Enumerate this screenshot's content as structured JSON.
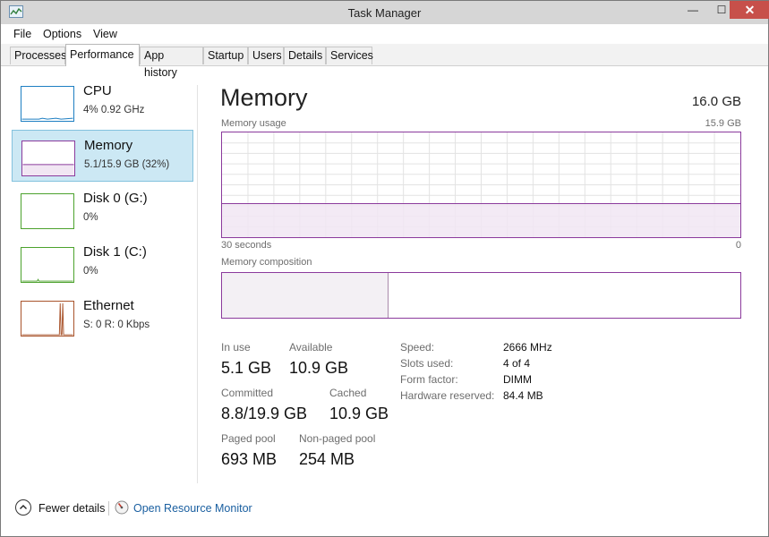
{
  "window": {
    "title": "Task Manager",
    "close_glyph": "✕",
    "minimize_glyph": "—",
    "maximize_glyph": "☐"
  },
  "menu": [
    "File",
    "Options",
    "View"
  ],
  "tabs": [
    "Processes",
    "Performance",
    "App history",
    "Startup",
    "Users",
    "Details",
    "Services"
  ],
  "active_tab": "Performance",
  "sidebar": {
    "items": [
      {
        "name": "CPU",
        "value": "4% 0.92 GHz",
        "color": "#1e7fc2",
        "icon": "cpu-graph"
      },
      {
        "name": "Memory",
        "value": "5.1/15.9 GB (32%)",
        "color": "#8b3a9c",
        "icon": "memory-graph",
        "level": 0.32
      },
      {
        "name": "Disk 0 (G:)",
        "value": "0%",
        "color": "#4ca22d",
        "icon": "disk-graph"
      },
      {
        "name": "Disk 1 (C:)",
        "value": "0%",
        "color": "#4ca22d",
        "icon": "disk-graph"
      },
      {
        "name": "Ethernet",
        "value": "S: 0 R: 0 Kbps",
        "color": "#a9542c",
        "icon": "ethernet-graph"
      }
    ]
  },
  "memory": {
    "title": "Memory",
    "total": "16.0 GB",
    "usage_label": "Memory usage",
    "usage_max": "15.9 GB",
    "time_label": "30 seconds",
    "time_end": "0",
    "composition_label": "Memory composition",
    "usage_fraction": 0.32,
    "accent": "#8b3a9c",
    "stats": {
      "in_use_label": "In use",
      "in_use": "5.1 GB",
      "available_label": "Available",
      "available": "10.9 GB",
      "committed_label": "Committed",
      "committed": "8.8/19.9 GB",
      "cached_label": "Cached",
      "cached": "10.9 GB",
      "paged_label": "Paged pool",
      "paged": "693 MB",
      "nonpaged_label": "Non-paged pool",
      "nonpaged": "254 MB"
    },
    "specs": [
      {
        "label": "Speed:",
        "value": "2666 MHz"
      },
      {
        "label": "Slots used:",
        "value": "4 of 4"
      },
      {
        "label": "Form factor:",
        "value": "DIMM"
      },
      {
        "label": "Hardware reserved:",
        "value": "84.4 MB"
      }
    ]
  },
  "footer": {
    "fewer_details": "Fewer details",
    "open_resource_monitor": "Open Resource Monitor"
  }
}
